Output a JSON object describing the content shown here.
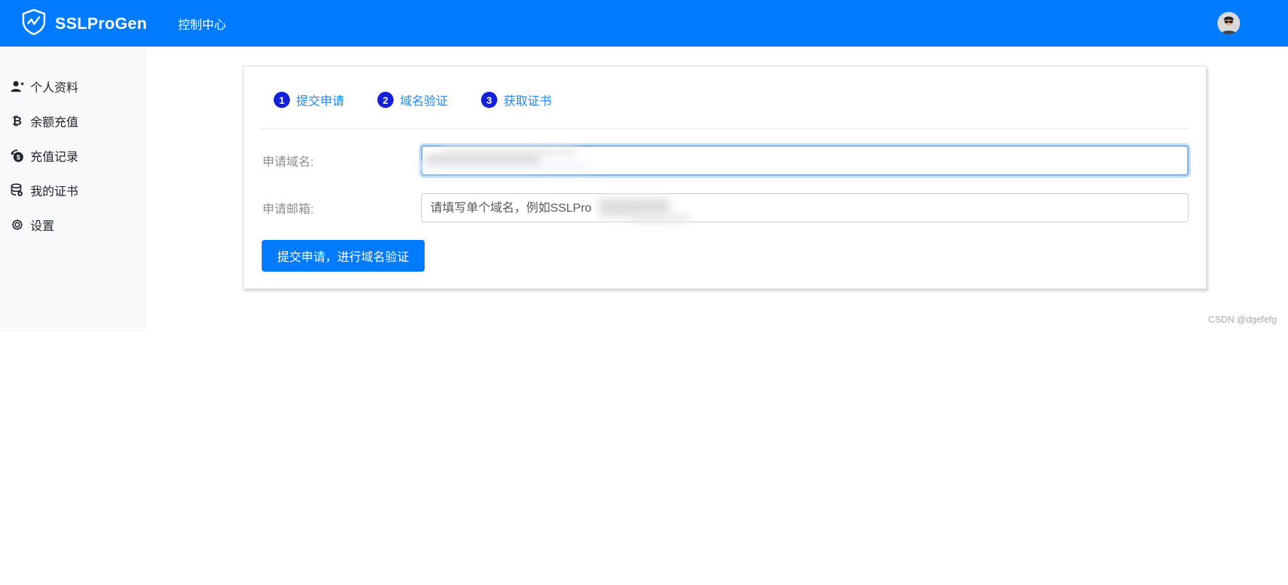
{
  "header": {
    "brand": "SSLProGen",
    "nav_control_center": "控制中心"
  },
  "sidebar": {
    "items": [
      {
        "label": "个人资料",
        "icon": "user-plus-icon"
      },
      {
        "label": "余额充值",
        "icon": "bitcoin-icon"
      },
      {
        "label": "充值记录",
        "icon": "recharge-history-icon"
      },
      {
        "label": "我的证书",
        "icon": "certificates-icon"
      },
      {
        "label": "设置",
        "icon": "gear-icon"
      }
    ]
  },
  "wizard": {
    "steps": [
      {
        "number": "1",
        "label": "提交申请"
      },
      {
        "number": "2",
        "label": "域名验证"
      },
      {
        "number": "3",
        "label": "获取证书"
      }
    ]
  },
  "form": {
    "domain": {
      "label": "申请域名:",
      "value": "",
      "redacted": true
    },
    "email": {
      "label": "申请邮箱:",
      "placeholder": "请填写单个域名，例如SSLPro",
      "redacted_tail": true
    },
    "submit_label": "提交申请，进行域名验证"
  },
  "watermark": "CSDN @dgefefg",
  "colors": {
    "header_blue": "#007bff",
    "button_blue": "#007bff",
    "step_circle_blue": "#1322d8",
    "step_label_blue": "#2287f6",
    "sidebar_bg": "#f8f9fa",
    "focus_ring": "#c3def7"
  }
}
